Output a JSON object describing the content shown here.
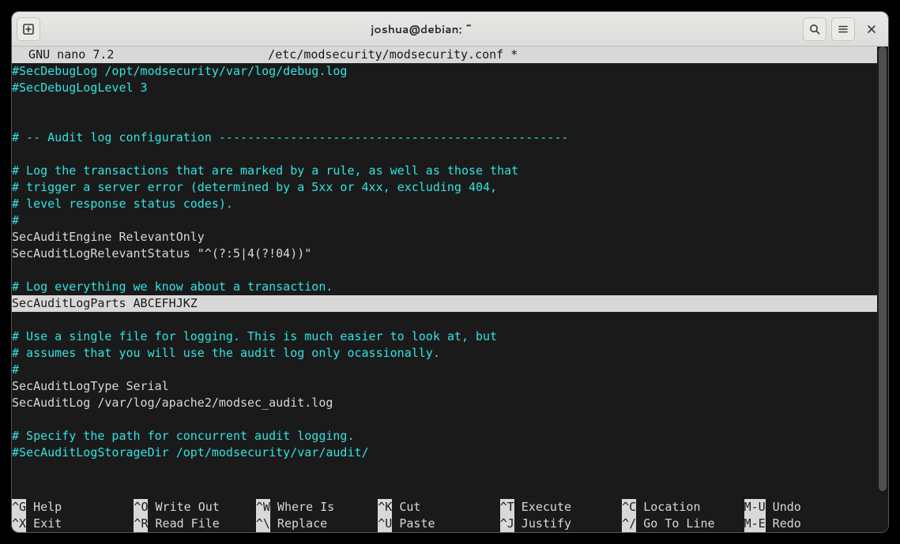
{
  "titlebar": {
    "title": "joshua@debian: ~"
  },
  "statusline": {
    "left": "  GNU nano 7.2",
    "center": "/etc/modsecurity/modsecurity.conf *"
  },
  "editor": {
    "lines": [
      {
        "text": "#SecDebugLog /opt/modsecurity/var/log/debug.log",
        "class": "c-comment"
      },
      {
        "text": "#SecDebugLogLevel 3",
        "class": "c-comment"
      },
      {
        "text": "",
        "class": "c-plain"
      },
      {
        "text": "",
        "class": "c-plain"
      },
      {
        "text": "# -- Audit log configuration -------------------------------------------------",
        "class": "c-comment"
      },
      {
        "text": "",
        "class": "c-plain"
      },
      {
        "text": "# Log the transactions that are marked by a rule, as well as those that",
        "class": "c-comment"
      },
      {
        "text": "# trigger a server error (determined by a 5xx or 4xx, excluding 404,",
        "class": "c-comment"
      },
      {
        "text": "# level response status codes).",
        "class": "c-comment"
      },
      {
        "text": "#",
        "class": "c-comment"
      },
      {
        "text": "SecAuditEngine RelevantOnly",
        "class": "c-plain"
      },
      {
        "text": "SecAuditLogRelevantStatus \"^(?:5|4(?!04))\"",
        "class": "c-plain"
      },
      {
        "text": "",
        "class": "c-plain"
      },
      {
        "text": "# Log everything we know about a transaction.",
        "class": "c-comment"
      },
      {
        "text": "SecAuditLogParts ABCEFHJKZ",
        "class": "c-plain",
        "highlight": true,
        "cursor": true
      },
      {
        "text": "",
        "class": "c-plain"
      },
      {
        "text": "# Use a single file for logging. This is much easier to look at, but",
        "class": "c-comment"
      },
      {
        "text": "# assumes that you will use the audit log only ocassionally.",
        "class": "c-comment"
      },
      {
        "text": "#",
        "class": "c-comment"
      },
      {
        "text": "SecAuditLogType Serial",
        "class": "c-plain"
      },
      {
        "text": "SecAuditLog /var/log/apache2/modsec_audit.log",
        "class": "c-plain"
      },
      {
        "text": "",
        "class": "c-plain"
      },
      {
        "text": "# Specify the path for concurrent audit logging.",
        "class": "c-comment"
      },
      {
        "text": "#SecAuditLogStorageDir /opt/modsecurity/var/audit/",
        "class": "c-comment"
      },
      {
        "text": "",
        "class": "c-plain"
      }
    ]
  },
  "help": {
    "row1": [
      {
        "key": "^G",
        "label": " Help"
      },
      {
        "key": "^O",
        "label": " Write Out"
      },
      {
        "key": "^W",
        "label": " Where Is"
      },
      {
        "key": "^K",
        "label": " Cut"
      },
      {
        "key": "^T",
        "label": " Execute"
      },
      {
        "key": "^C",
        "label": " Location"
      },
      {
        "key": "M-U",
        "label": " Undo"
      }
    ],
    "row2": [
      {
        "key": "^X",
        "label": " Exit"
      },
      {
        "key": "^R",
        "label": " Read File"
      },
      {
        "key": "^\\",
        "label": " Replace"
      },
      {
        "key": "^U",
        "label": " Paste"
      },
      {
        "key": "^J",
        "label": " Justify"
      },
      {
        "key": "^/",
        "label": " Go To Line"
      },
      {
        "key": "M-E",
        "label": " Redo"
      }
    ]
  }
}
